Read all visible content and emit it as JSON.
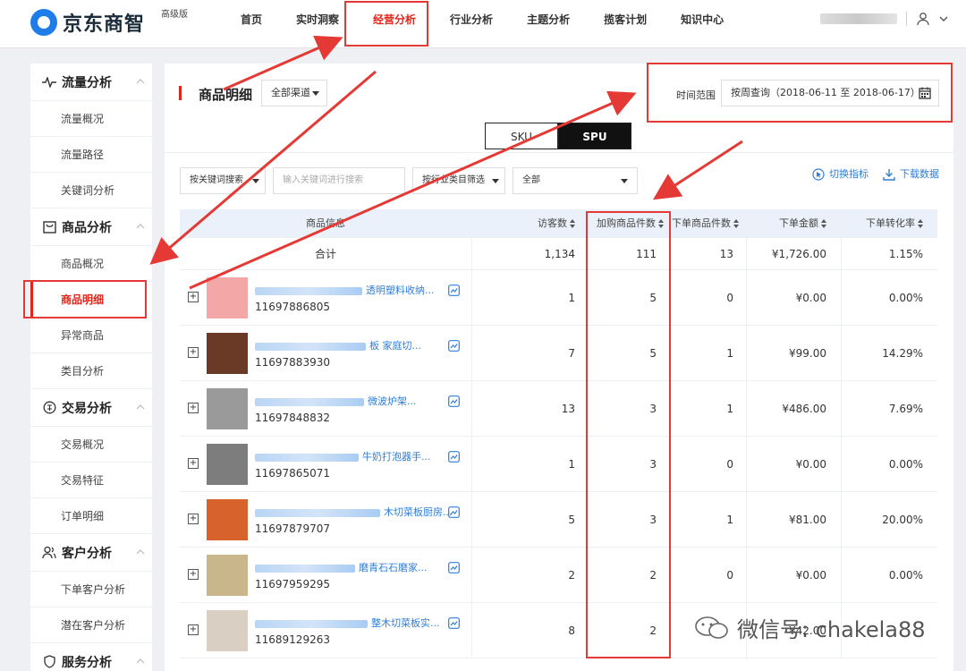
{
  "brand": {
    "name": "京东商智",
    "badge": "高级版"
  },
  "nav": [
    "首页",
    "实时洞察",
    "经营分析",
    "行业分析",
    "主题分析",
    "揽客计划",
    "知识中心"
  ],
  "sidebar": {
    "groups": [
      {
        "label": "流量分析",
        "items": [
          "流量概况",
          "流量路径",
          "关键词分析"
        ]
      },
      {
        "label": "商品分析",
        "items": [
          "商品概况",
          "商品明细",
          "异常商品",
          "类目分析"
        ]
      },
      {
        "label": "交易分析",
        "items": [
          "交易概况",
          "交易特征",
          "订单明细"
        ]
      },
      {
        "label": "客户分析",
        "items": [
          "下单客户分析",
          "潜在客户分析"
        ]
      },
      {
        "label": "服务分析",
        "items": []
      }
    ]
  },
  "page": {
    "title": "商品明细",
    "channel": "全部渠道",
    "time_label": "时间范围",
    "time_value": "按周查询（2018-06-11 至 2018-06-17）",
    "toggle": {
      "sku": "SKU",
      "spu": "SPU"
    },
    "filters": {
      "keyword_mode": "按关键词搜索",
      "search_placeholder": "输入关键词进行搜索",
      "category_mode": "按行业类目筛选",
      "category_value": "全部"
    },
    "tools": {
      "switch_metrics": "切换指标",
      "download": "下载数据"
    }
  },
  "table": {
    "headers": [
      "商品信息",
      "访客数",
      "加购商品件数",
      "下单商品件数",
      "下单金额",
      "下单转化率"
    ],
    "total": {
      "label": "合计",
      "visitors": "1,134",
      "cart": "111",
      "orders": "13",
      "amount": "¥1,726.00",
      "rate": "1.15%"
    },
    "rows": [
      {
        "name_tail": "透明塑料收纳...",
        "id": "11697886805",
        "visitors": "1",
        "cart": "5",
        "orders": "0",
        "amount": "¥0.00",
        "rate": "0.00%",
        "thumb_color": "#f3a7a7"
      },
      {
        "name_tail": "板 家庭切...",
        "id": "11697883930",
        "visitors": "7",
        "cart": "5",
        "orders": "1",
        "amount": "¥99.00",
        "rate": "14.29%",
        "thumb_color": "#6b3a26"
      },
      {
        "name_tail": "微波炉架...",
        "id": "11697848832",
        "visitors": "13",
        "cart": "3",
        "orders": "1",
        "amount": "¥486.00",
        "rate": "7.69%",
        "thumb_color": "#9a9a9a"
      },
      {
        "name_tail": "牛奶打泡器手...",
        "id": "11697865071",
        "visitors": "1",
        "cart": "3",
        "orders": "0",
        "amount": "¥0.00",
        "rate": "0.00%",
        "thumb_color": "#7d7d7d"
      },
      {
        "name_tail": "木切菜板厨房...",
        "id": "11697879707",
        "visitors": "5",
        "cart": "3",
        "orders": "1",
        "amount": "¥81.00",
        "rate": "20.00%",
        "thumb_color": "#d8622c"
      },
      {
        "name_tail": "磨青石石磨家...",
        "id": "11697959295",
        "visitors": "2",
        "cart": "2",
        "orders": "0",
        "amount": "¥0.00",
        "rate": "0.00%",
        "thumb_color": "#c9b68a"
      },
      {
        "name_tail": "整木切菜板实...",
        "id": "11689129263",
        "visitors": "8",
        "cart": "2",
        "orders": "",
        "amount": "¥42.00",
        "rate": "",
        "thumb_color": "#d9cfc3"
      }
    ]
  },
  "watermark": "微信号: chakela88",
  "colors": {
    "accent": "#e1251b",
    "link": "#2e7ed8",
    "brand_blue": "#1f7dea",
    "annotation": "#e53935"
  }
}
